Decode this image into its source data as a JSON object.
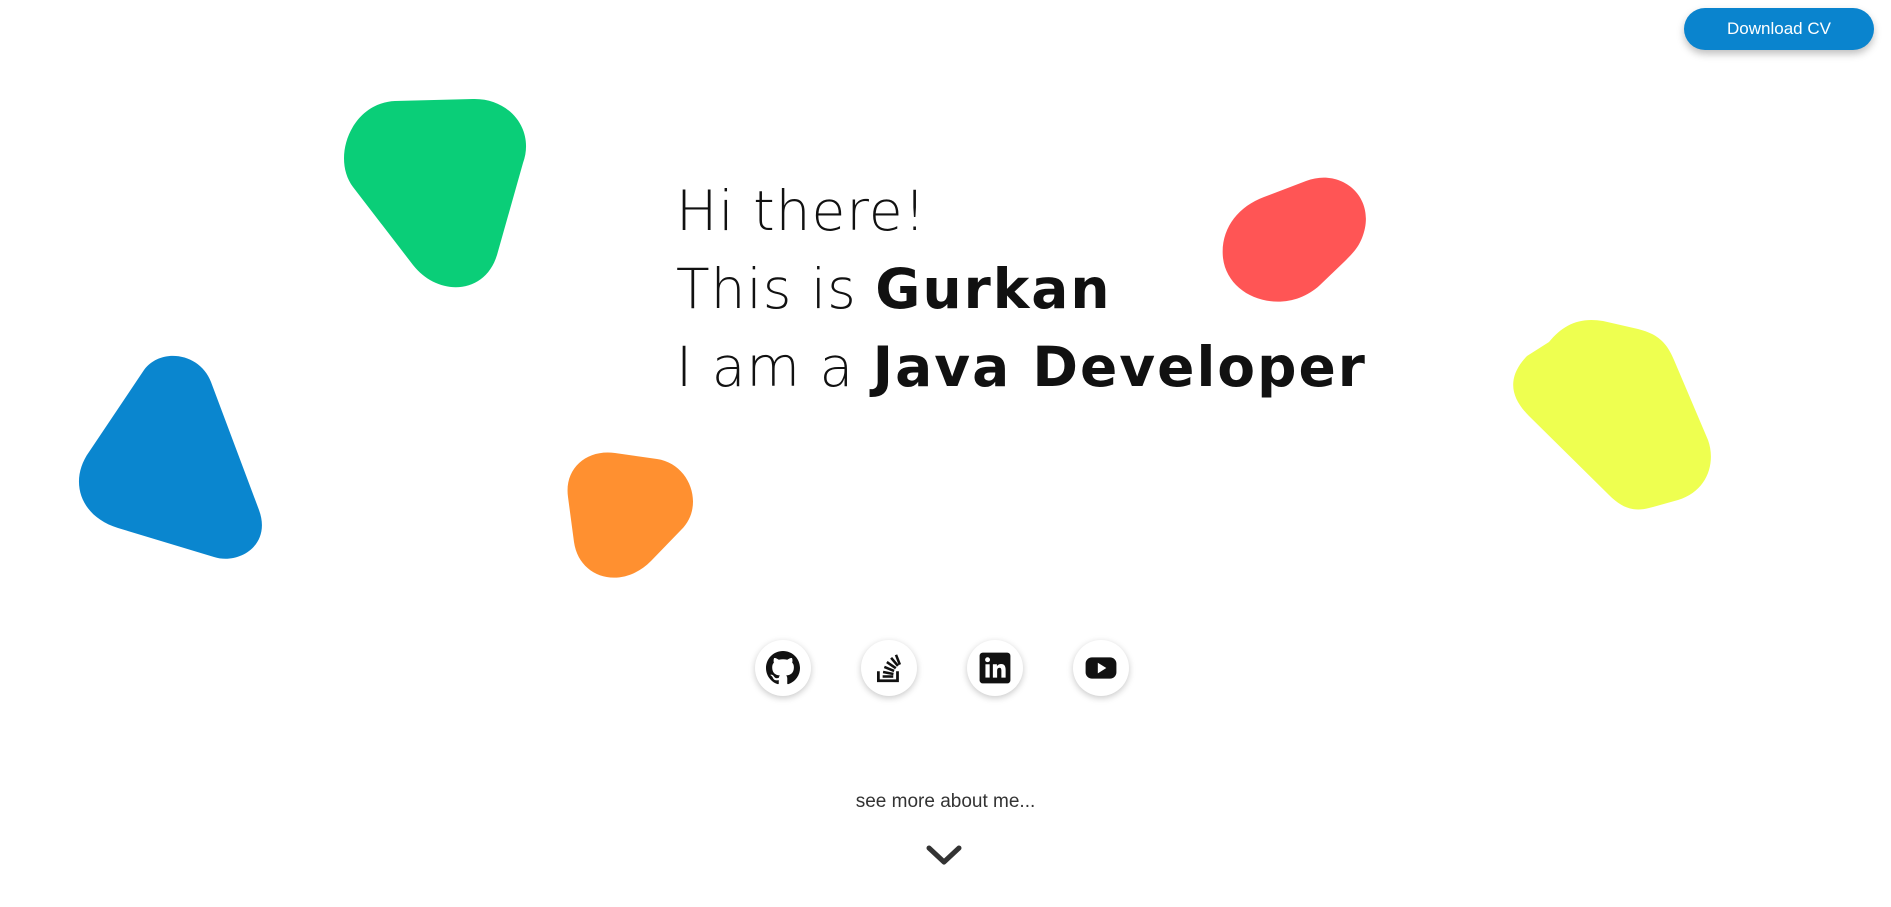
{
  "header": {
    "download_cv_label": "Download CV",
    "accent_color": "#0a84ce"
  },
  "hero": {
    "line1": "Hi there!",
    "line2_prefix": "This is ",
    "line2_name": "Gurkan",
    "line3_prefix": "I am a ",
    "line3_role": "Java Developer"
  },
  "decorations": {
    "shapes": [
      {
        "name": "green-shape",
        "color": "#0ace78"
      },
      {
        "name": "blue-shape",
        "color": "#0a86cf"
      },
      {
        "name": "orange-shape",
        "color": "#ff9030"
      },
      {
        "name": "red-shape",
        "color": "#ff5555"
      },
      {
        "name": "yellow-shape",
        "color": "#eeff50"
      }
    ]
  },
  "socials": [
    {
      "icon": "github-icon"
    },
    {
      "icon": "stackoverflow-icon"
    },
    {
      "icon": "linkedin-icon"
    },
    {
      "icon": "youtube-icon"
    }
  ],
  "footer": {
    "see_more_label": "see more about me...",
    "icon": "chevron-down-icon"
  }
}
